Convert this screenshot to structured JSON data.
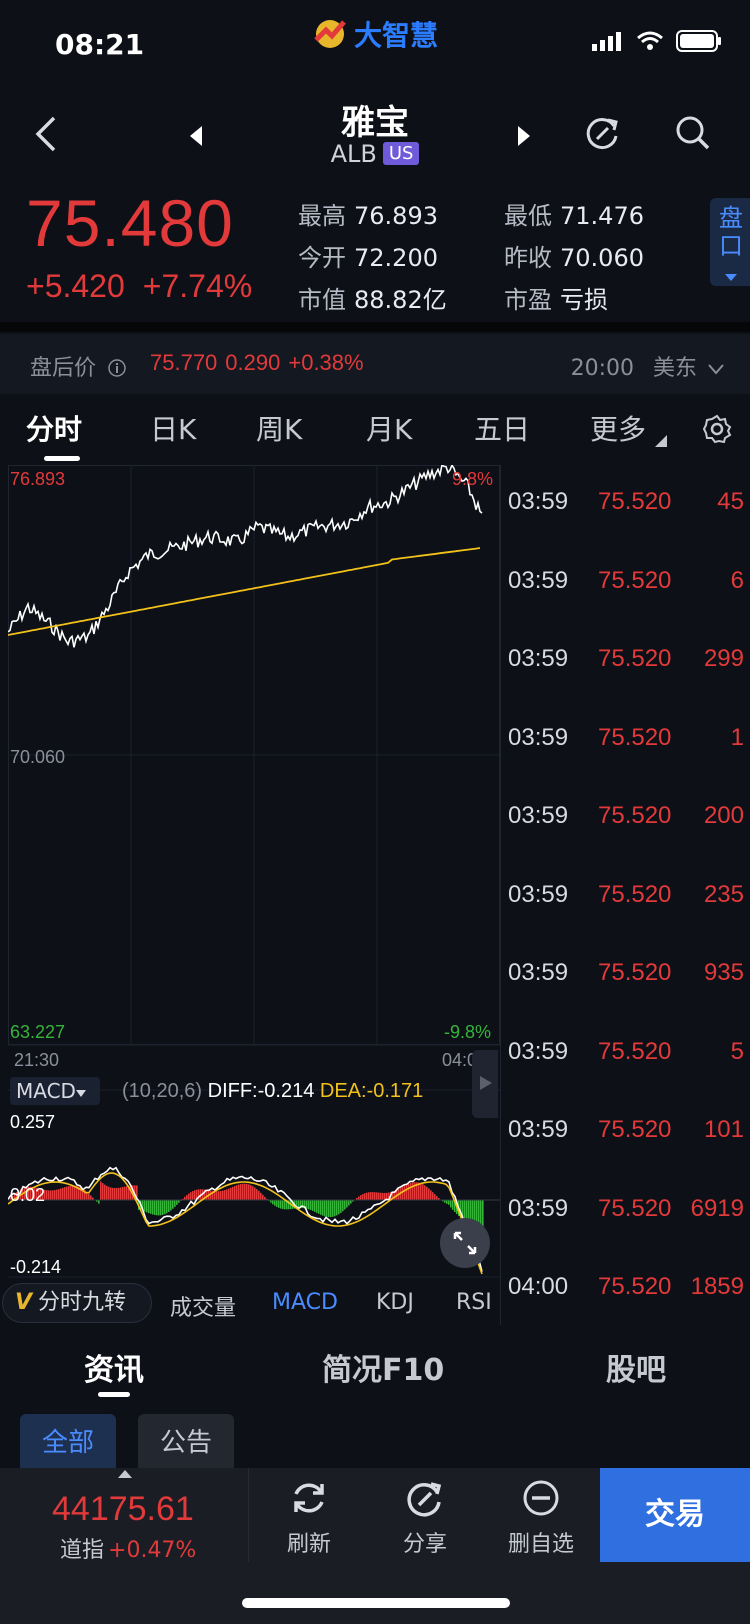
{
  "status": {
    "time": "08:21",
    "app_name": "大智慧"
  },
  "header": {
    "name": "雅宝",
    "code": "ALB",
    "market": "US"
  },
  "quote": {
    "price": "75.480",
    "change": "+5.420",
    "change_pct": "+7.74%",
    "stats": [
      {
        "label": "最高",
        "value": "76.893"
      },
      {
        "label": "最低",
        "value": "71.476"
      },
      {
        "label": "今开",
        "value": "72.200"
      },
      {
        "label": "昨收",
        "value": "70.060"
      },
      {
        "label": "市值",
        "value": "88.82亿"
      },
      {
        "label": "市盈",
        "value": "亏损"
      }
    ],
    "pankou_label": "盘口"
  },
  "after_hours": {
    "label": "盘后价",
    "price": "75.770",
    "change": "0.290",
    "pct": "+0.38%",
    "time": "20:00",
    "zone": "美东"
  },
  "period_tabs": [
    "分时",
    "日K",
    "周K",
    "月K",
    "五日",
    "更多"
  ],
  "chart": {
    "high_label": "76.893",
    "high_pct": "9.8%",
    "mid_label": "70.060",
    "low_label": "63.227",
    "low_pct": "-9.8%",
    "start_time": "21:30",
    "end_time": "04:00",
    "macd_name": "MACD",
    "macd_params": "(10,20,6)",
    "diff": "DIFF:-0.214",
    "dea": "DEA:-0.171",
    "macd_top": "0.257",
    "macd_zero": "0.02",
    "macd_bottom": "-0.214",
    "colors": {
      "price": "#ffffff",
      "avg": "#f2c21b",
      "up": "#e23a3a",
      "down": "#36b43a"
    }
  },
  "ticks": [
    {
      "time": "03:59",
      "price": "75.520",
      "qty": "45"
    },
    {
      "time": "03:59",
      "price": "75.520",
      "qty": "6"
    },
    {
      "time": "03:59",
      "price": "75.520",
      "qty": "299"
    },
    {
      "time": "03:59",
      "price": "75.520",
      "qty": "1"
    },
    {
      "time": "03:59",
      "price": "75.520",
      "qty": "200"
    },
    {
      "time": "03:59",
      "price": "75.520",
      "qty": "235"
    },
    {
      "time": "03:59",
      "price": "75.520",
      "qty": "935"
    },
    {
      "time": "03:59",
      "price": "75.520",
      "qty": "5"
    },
    {
      "time": "03:59",
      "price": "75.520",
      "qty": "101"
    },
    {
      "time": "03:59",
      "price": "75.520",
      "qty": "6919"
    },
    {
      "time": "04:00",
      "price": "75.520",
      "qty": "1859"
    }
  ],
  "indicator_tabs": {
    "nine_turn": "分时九转",
    "items": [
      "成交量",
      "MACD",
      "KDJ",
      "RSI"
    ]
  },
  "info_tabs": [
    "资讯",
    "简况F10",
    "股吧"
  ],
  "info_chips": [
    "全部",
    "公告"
  ],
  "bottom": {
    "index_value": "44175.61",
    "index_name": "道指",
    "index_pct": "+0.47%",
    "buttons": [
      "刷新",
      "分享",
      "删自选"
    ],
    "trade": "交易"
  }
}
